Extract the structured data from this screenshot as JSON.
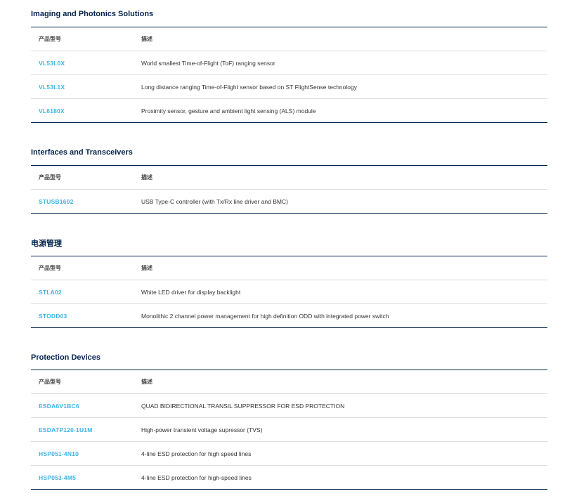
{
  "headers": {
    "part": "产品型号",
    "description": "描述"
  },
  "sections": [
    {
      "title": "Imaging and Photonics Solutions",
      "rows": [
        {
          "part": "VL53L0X",
          "description": "World smallest Time-of-Flight (ToF) ranging sensor"
        },
        {
          "part": "VL53L1X",
          "description": "Long distance ranging Time-of-Flight sensor based on ST FlightSense technology"
        },
        {
          "part": "VL6180X",
          "description": "Proximity sensor, gesture and ambient light sensing (ALS) module"
        }
      ]
    },
    {
      "title": "Interfaces and Transceivers",
      "rows": [
        {
          "part": "STUSB1602",
          "description": "USB Type-C controller (with Tx/Rx line driver and BMC)"
        }
      ]
    },
    {
      "title": "电源管理",
      "rows": [
        {
          "part": "STLA02",
          "description": "White LED driver for display backlight"
        },
        {
          "part": "STODD03",
          "description": "Monolithic 2 channel power management for high definition ODD with integrated power switch"
        }
      ]
    },
    {
      "title": "Protection Devices",
      "rows": [
        {
          "part": "ESDA6V1BC6",
          "description": "QUAD BIDIRECTIONAL TRANSIL SUPPRESSOR FOR ESD PROTECTION"
        },
        {
          "part": "ESDA7P120-1U1M",
          "description": "High-power transient voltage supressor (TVS)"
        },
        {
          "part": "HSP051-4N10",
          "description": "4-line ESD protection for high speed lines"
        },
        {
          "part": "HSP053-4M5",
          "description": "4-line ESD protection for high-speed lines"
        }
      ]
    }
  ]
}
